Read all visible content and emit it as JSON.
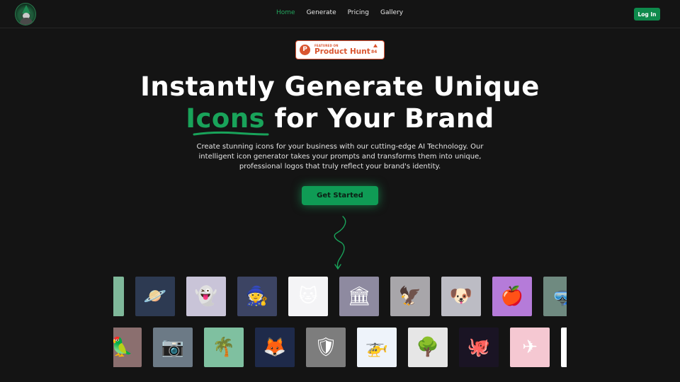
{
  "nav": {
    "logo_alt": "wizard-logo",
    "links": [
      {
        "label": "Home",
        "active": true
      },
      {
        "label": "Generate",
        "active": false
      },
      {
        "label": "Pricing",
        "active": false
      },
      {
        "label": "Gallery",
        "active": false
      }
    ],
    "login_label": "Log In"
  },
  "product_hunt": {
    "featured_label": "FEATURED ON",
    "name": "Product Hunt",
    "logo_letter": "P",
    "upvotes": "84"
  },
  "hero": {
    "headline_line1": "Instantly Generate Unique",
    "headline_accent": "Icons",
    "headline_rest": " for Your Brand",
    "subtitle": "Create stunning icons for your business with our cutting-edge AI Technology. Our intelligent icon generator takes your prompts and transforms them into unique, professional logos that truly reflect your brand's identity.",
    "cta_label": "Get Started"
  },
  "colors": {
    "accent": "#19a35a",
    "background": "#141414",
    "product_hunt": "#da552f"
  },
  "gallery": {
    "row1": [
      {
        "name": "partial-icon",
        "bg": "#7fb89a",
        "glyph": "▮"
      },
      {
        "name": "astronaut-planet",
        "bg": "#2d3a52",
        "glyph": "🪐"
      },
      {
        "name": "ghost",
        "bg": "#c9c4d8",
        "glyph": "👻"
      },
      {
        "name": "wizard",
        "bg": "#3c4463",
        "glyph": "🧙"
      },
      {
        "name": "white-cat",
        "bg": "#f4f4f6",
        "glyph": "🐱"
      },
      {
        "name": "bank-building",
        "bg": "#8e8aa0",
        "glyph": "🏛"
      },
      {
        "name": "red-eagle",
        "bg": "#a8a6aa",
        "glyph": "🦅"
      },
      {
        "name": "puppy",
        "bg": "#bcbcc4",
        "glyph": "🐶"
      },
      {
        "name": "red-apple",
        "bg": "#b57bd9",
        "glyph": "🍎"
      },
      {
        "name": "partial-diver",
        "bg": "#6f8a80",
        "glyph": "🤿"
      }
    ],
    "row2": [
      {
        "name": "parrot",
        "bg": "#8b6f6f",
        "glyph": "🦜"
      },
      {
        "name": "camera",
        "bg": "#6c7a86",
        "glyph": "📷"
      },
      {
        "name": "palm-tree",
        "bg": "#7fc0a0",
        "glyph": "🌴"
      },
      {
        "name": "fox",
        "bg": "#1e2a4a",
        "glyph": "🦊"
      },
      {
        "name": "green-shield",
        "bg": "#7d7d7d",
        "glyph": "🛡"
      },
      {
        "name": "helicopter",
        "bg": "#eef3fa",
        "glyph": "🚁"
      },
      {
        "name": "tree",
        "bg": "#e6e6e6",
        "glyph": "🌳"
      },
      {
        "name": "octopus",
        "bg": "#1a1424",
        "glyph": "🐙"
      },
      {
        "name": "airplane",
        "bg": "#f5c8d2",
        "glyph": "✈"
      },
      {
        "name": "partial-white",
        "bg": "#ffffff",
        "glyph": ""
      }
    ]
  }
}
